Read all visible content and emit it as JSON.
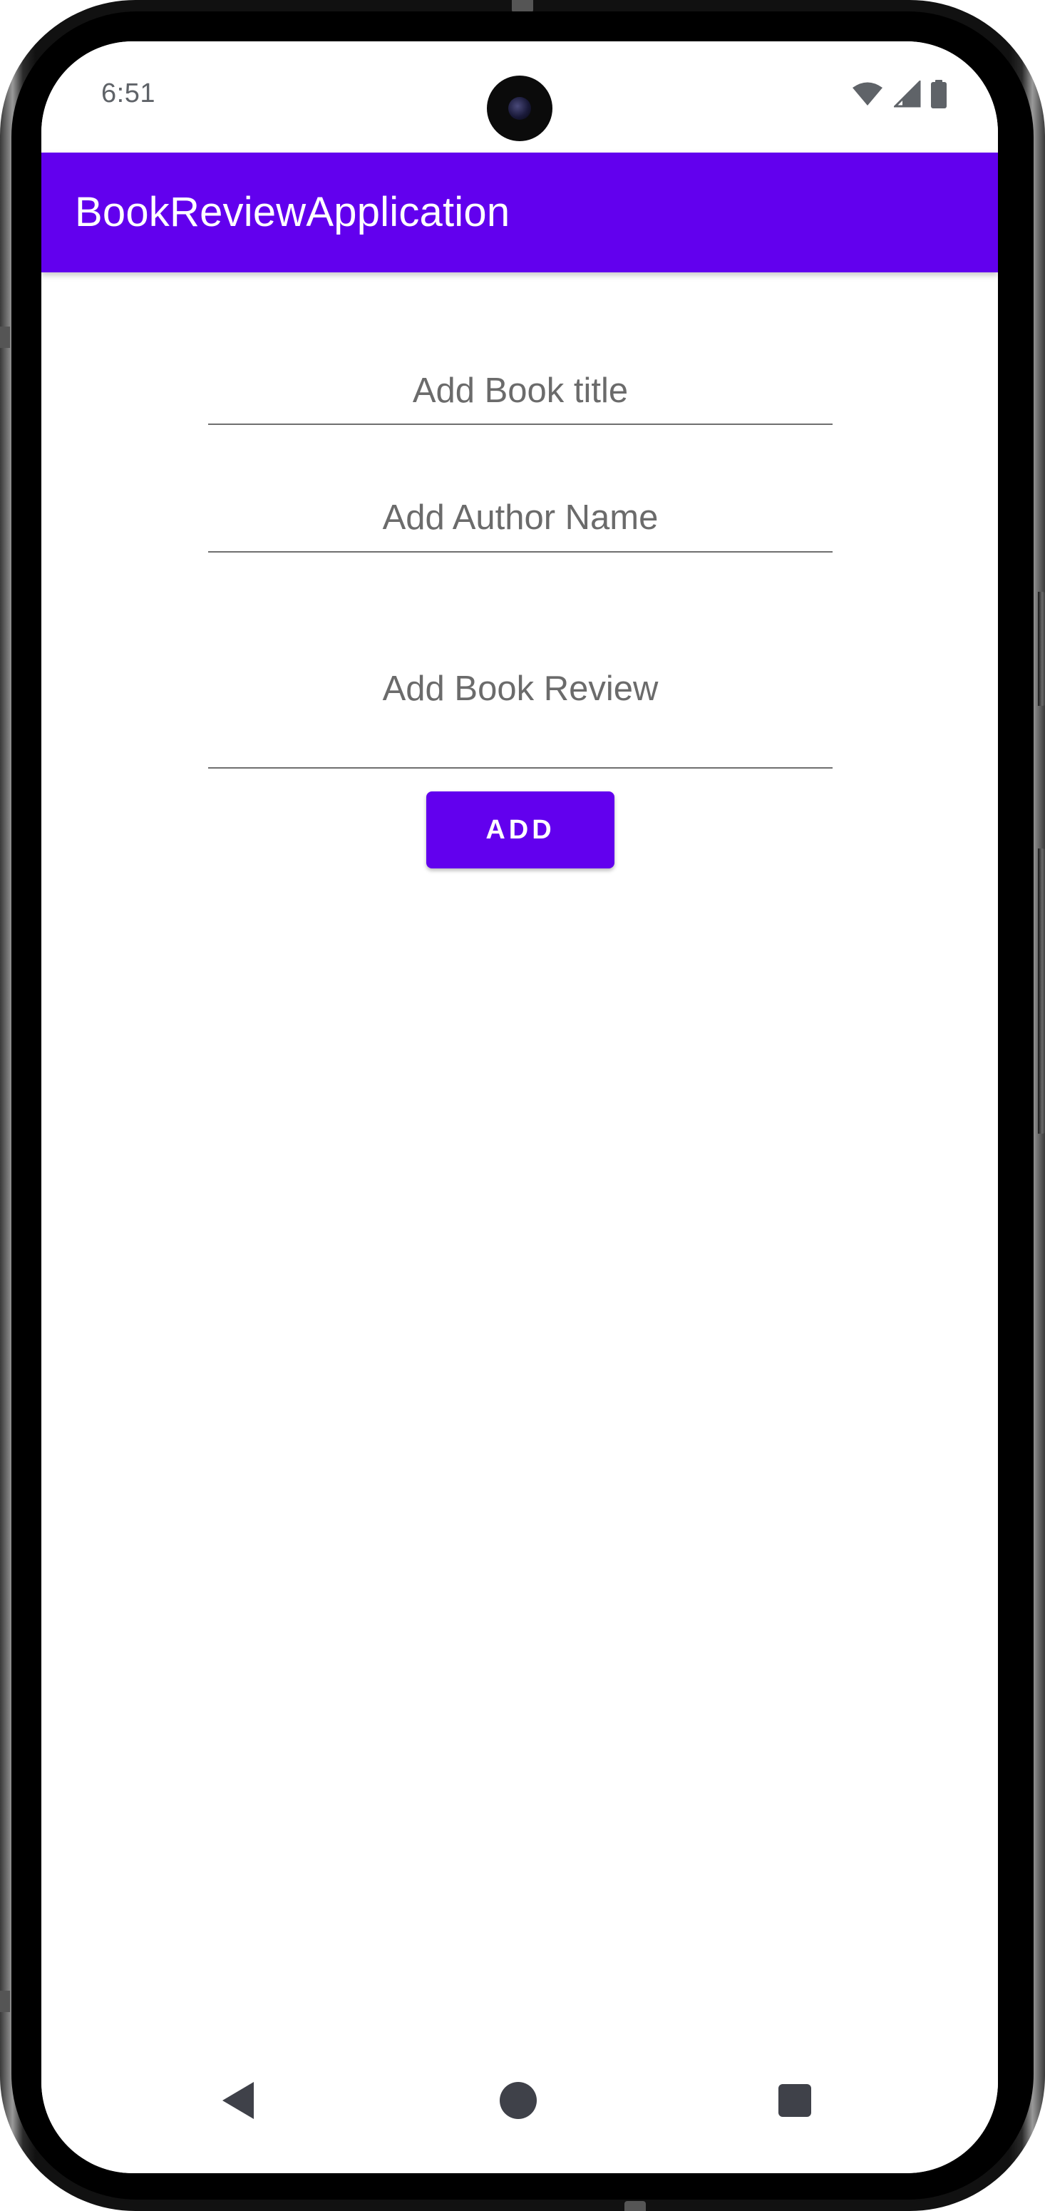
{
  "status_bar": {
    "time": "6:51",
    "icons": [
      "wifi-icon",
      "signal-icon",
      "battery-icon"
    ]
  },
  "app_bar": {
    "title": "BookReviewApplication",
    "color": "#6200ee"
  },
  "form": {
    "book_title_placeholder": "Add Book title",
    "author_name_placeholder": "Add Author Name",
    "book_review_placeholder": "Add Book Review",
    "add_button_label": "ADD"
  },
  "nav_bar": {
    "buttons": [
      "back-icon",
      "home-icon",
      "recents-icon"
    ]
  },
  "colors": {
    "primary": "#6200ee",
    "hint_text": "#6b6b6b",
    "nav_icons": "#3f4149"
  }
}
